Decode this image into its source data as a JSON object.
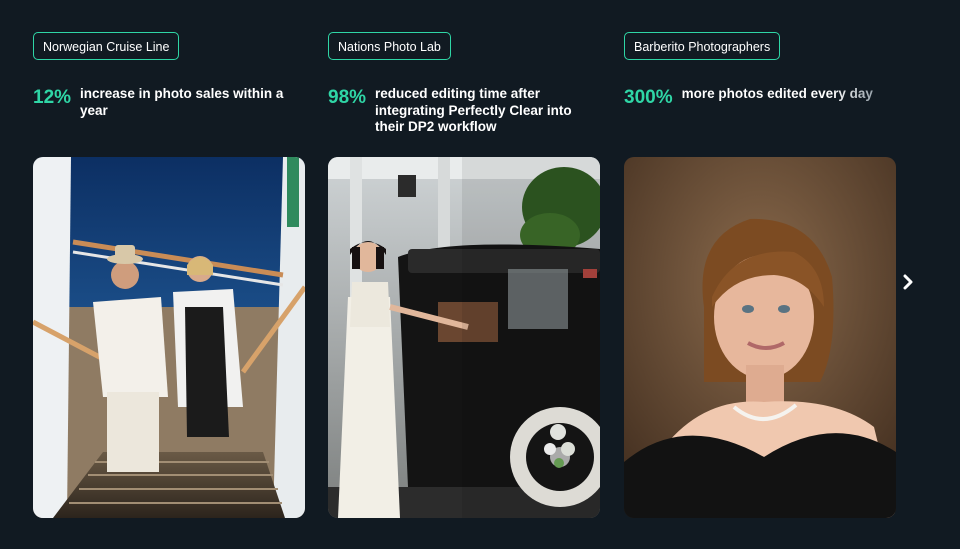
{
  "cards": [
    {
      "company": "Norwegian Cruise Line",
      "stat_value": "12%",
      "stat_text": "increase in photo sales within a\nyear"
    },
    {
      "company": "Nations Photo Lab",
      "stat_value": "98%",
      "stat_text": "reduced editing time after\nintegrating Perfectly Clear into\ntheir DP2 workflow"
    },
    {
      "company": "Barberito Photographers",
      "stat_value": "300%",
      "stat_text": "more photos edited every day"
    }
  ],
  "colors": {
    "background": "#111a22",
    "accent": "#2fd6a6",
    "text": "#ffffff"
  },
  "icons": {
    "next": "chevron-right-icon"
  }
}
